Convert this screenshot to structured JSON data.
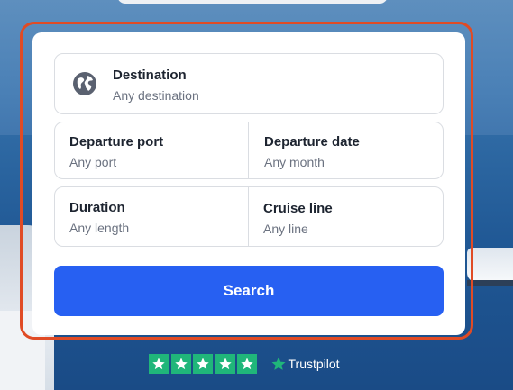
{
  "form": {
    "destination": {
      "label": "Destination",
      "value": "Any destination",
      "icon": "globe-icon"
    },
    "departure_port": {
      "label": "Departure port",
      "value": "Any port"
    },
    "departure_date": {
      "label": "Departure date",
      "value": "Any month"
    },
    "duration": {
      "label": "Duration",
      "value": "Any length"
    },
    "cruise_line": {
      "label": "Cruise line",
      "value": "Any line"
    },
    "search_label": "Search"
  },
  "trustpilot": {
    "stars": 5,
    "brand": "Trustpilot"
  },
  "colors": {
    "accent": "#2760f2",
    "highlight": "#e04b25",
    "trustpilot_green": "#20b67a"
  }
}
